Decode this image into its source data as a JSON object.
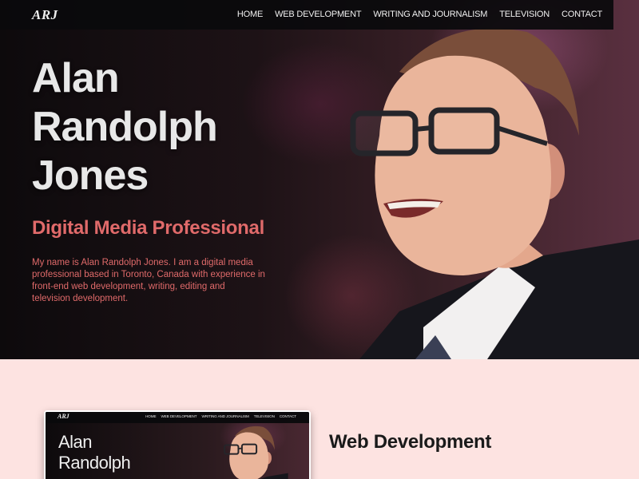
{
  "brand": {
    "logo": "ARJ"
  },
  "nav": {
    "items": [
      {
        "label": "HOME"
      },
      {
        "label": "WEB DEVELOPMENT"
      },
      {
        "label": "WRITING AND JOURNALISM"
      },
      {
        "label": "TELEVISION"
      },
      {
        "label": "CONTACT"
      }
    ]
  },
  "hero": {
    "title_lines": [
      "Alan",
      "Randolph",
      "Jones"
    ],
    "subtitle": "Digital Media Professional",
    "intro": "My name is Alan Randolph Jones. I am a digital media professional based in Toronto, Canada with experience in front-end web development, writing, editing and television development."
  },
  "preview_card": {
    "logo": "ARJ",
    "nav": [
      "HOME",
      "WEB DEVELOPMENT",
      "WRITING AND JOURNALISM",
      "TELEVISION",
      "CONTACT"
    ],
    "title_lines": [
      "Alan",
      "Randolph"
    ]
  },
  "sections": {
    "web_dev": {
      "heading": "Web Development"
    }
  },
  "colors": {
    "accent": "#e06a6a",
    "page_background": "#fde3e1",
    "navbar": "#0a0a0c"
  }
}
